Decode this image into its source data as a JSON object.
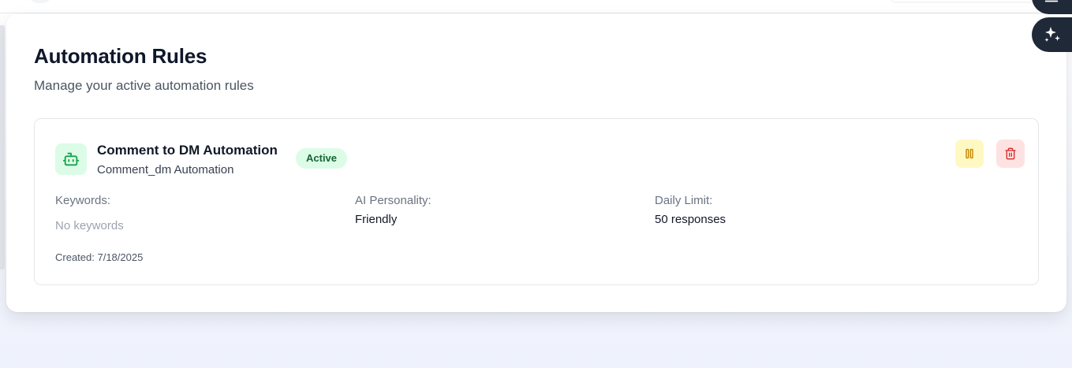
{
  "page": {
    "title": "Automation Rules",
    "subtitle": "Manage your active automation rules"
  },
  "rule": {
    "name": "Comment to DM Automation",
    "type": "Comment_dm Automation",
    "status": "Active",
    "icon": "bot-icon",
    "keywords_label": "Keywords:",
    "keywords_value": "No keywords",
    "personality_label": "AI Personality:",
    "personality_value": "Friendly",
    "limit_label": "Daily Limit:",
    "limit_value": "50 responses",
    "created": "Created: 7/18/2025"
  },
  "actions": {
    "pause_icon": "pause-icon",
    "delete_icon": "trash-icon"
  },
  "floating": {
    "menu_icon": "menu-icon",
    "ai_icon": "sparkles-icon"
  },
  "colors": {
    "status_bg": "#dcfce7",
    "status_text": "#166534",
    "pause_bg": "#fef9c3",
    "pause_icon": "#ca8a04",
    "delete_bg": "#fee2e2",
    "delete_icon": "#dc2626",
    "fab_bg": "#1f2937"
  }
}
